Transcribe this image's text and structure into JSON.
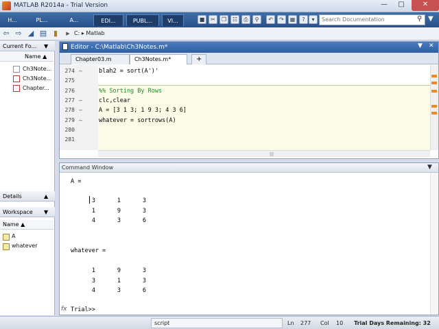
{
  "window": {
    "title": "MATLAB R2014a - Trial Version"
  },
  "toolstrip": {
    "tabs": [
      "H...",
      "PL...",
      "A...",
      "EDI...",
      "PUBL...",
      "VI..."
    ],
    "search_placeholder": "Search Documentation"
  },
  "address": {
    "path": "C: ▸ Matlab"
  },
  "current_folder": {
    "title": "Current Fo...",
    "column": "Name ▲",
    "files": [
      "Ch3Note...",
      "Ch3Note...",
      "Chapter..."
    ]
  },
  "details": {
    "title": "Details"
  },
  "workspace": {
    "title": "Workspace",
    "column": "Name ▲",
    "vars": [
      "A",
      "whatever"
    ]
  },
  "editor": {
    "title": "Editor - C:\\Matlab\\Ch3Notes.m*",
    "tabs": [
      "Chapter03.m",
      "Ch3Notes.m*"
    ],
    "add_tab": "+",
    "lines": [
      {
        "n": "274",
        "dash": "–",
        "code": "blah2 = sort(A')'",
        "comment": false
      },
      {
        "n": "275",
        "dash": "",
        "code": "",
        "comment": false
      },
      {
        "n": "276",
        "dash": "",
        "code": "%% Sorting By Rows",
        "comment": true
      },
      {
        "n": "277",
        "dash": "–",
        "code": "clc,clear",
        "comment": false
      },
      {
        "n": "278",
        "dash": "–",
        "code": "A = [3 1 3; 1 9 3; 4 3 6]",
        "comment": false
      },
      {
        "n": "279",
        "dash": "–",
        "code": "whatever = sortrows(A)",
        "comment": false
      },
      {
        "n": "280",
        "dash": "",
        "code": "",
        "comment": false
      },
      {
        "n": "281",
        "dash": "",
        "code": "",
        "comment": false
      }
    ]
  },
  "command_window": {
    "title": "Command Window",
    "a_label": "A =",
    "a_rows": [
      [
        "3",
        "1",
        "3"
      ],
      [
        "1",
        "9",
        "3"
      ],
      [
        "4",
        "3",
        "6"
      ]
    ],
    "w_label": "whatever =",
    "w_rows": [
      [
        "1",
        "9",
        "3"
      ],
      [
        "3",
        "1",
        "3"
      ],
      [
        "4",
        "3",
        "6"
      ]
    ],
    "prompt_icon": "fx",
    "prompt": "Trial>>"
  },
  "status": {
    "mode": "script",
    "ln_label": "Ln",
    "ln": "277",
    "col_label": "Col",
    "col": "10",
    "trial": "Trial Days Remaining: 32"
  }
}
